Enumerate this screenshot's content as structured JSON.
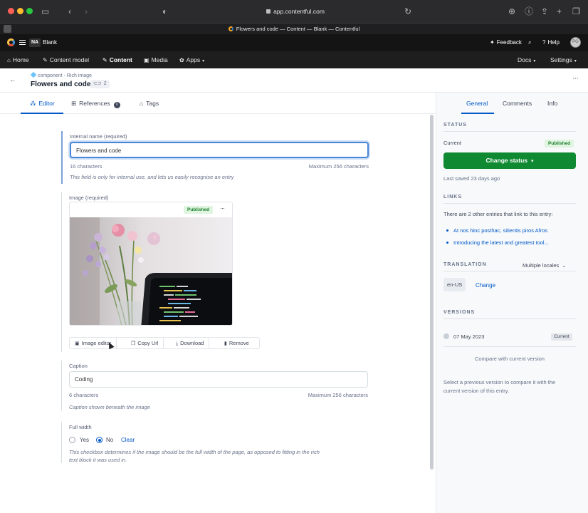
{
  "browser": {
    "url": "app.contentful.com",
    "tab_title": "Flowers and code — Content — Blank — Contentful"
  },
  "app_top": {
    "space_initials": "NA",
    "environment": "Blank",
    "feedback": "Feedback",
    "help": "Help",
    "avatar_initials": "PG"
  },
  "nav": {
    "home": "Home",
    "content_model": "Content model",
    "content": "Content",
    "media": "Media",
    "apps": "Apps",
    "docs": "Docs",
    "settings": "Settings"
  },
  "entry": {
    "content_type": "component - Rich image",
    "title": "Flowers and code",
    "reference_count": "2"
  },
  "editor_tabs": {
    "editor": "Editor",
    "references": "References",
    "tags": "Tags"
  },
  "fields": {
    "internal_name": {
      "label": "Internal name (required)",
      "value": "Flowers and code",
      "char_count": "16 characters",
      "max": "Maximum 256 characters",
      "help": "This field is only for internal use, and lets us easily recognise an entry"
    },
    "image": {
      "label": "Image (required)",
      "status": "Published",
      "actions": {
        "image_editor": "Image editor",
        "copy_url": "Copy Url",
        "download": "Download",
        "remove": "Remove"
      }
    },
    "caption": {
      "label": "Caption",
      "value": "Coding",
      "char_count": "6 characters",
      "max": "Maximum 256 characters",
      "help": "Caption shown beneath the image"
    },
    "full_width": {
      "label": "Full width",
      "yes": "Yes",
      "no": "No",
      "selected": "No",
      "clear": "Clear",
      "help_line1": "This checkbox determines if the image should be the full width of the page, as opposed to fitting in the rich",
      "help_line2": "text block it was used in."
    }
  },
  "sidebar": {
    "tabs": {
      "general": "General",
      "comments": "Comments",
      "info": "Info"
    },
    "status": {
      "heading": "STATUS",
      "current_label": "Current",
      "current_badge": "Published",
      "change_status": "Change status",
      "last_saved": "Last saved 23 days ago"
    },
    "links": {
      "heading": "LINKS",
      "summary": "There are 2 other entries that link to this entry:",
      "items": [
        "At nos hinc posthac, sitientis piros Afros",
        "Introducing the latest and greatest tool..."
      ]
    },
    "translation": {
      "heading": "TRANSLATION",
      "mode": "Multiple locales",
      "locale": "en-US",
      "change": "Change"
    },
    "versions": {
      "heading": "VERSIONS",
      "date": "07 May 2023",
      "badge": "Current",
      "compare": "Compare with current version",
      "hint_line1": "Select a previous version to compare it with the",
      "hint_line2": "current version of this entry."
    }
  },
  "colors": {
    "primary_blue": "#0059c8",
    "success_green": "#0f8a33",
    "nav_bg": "#1e1e1e"
  }
}
